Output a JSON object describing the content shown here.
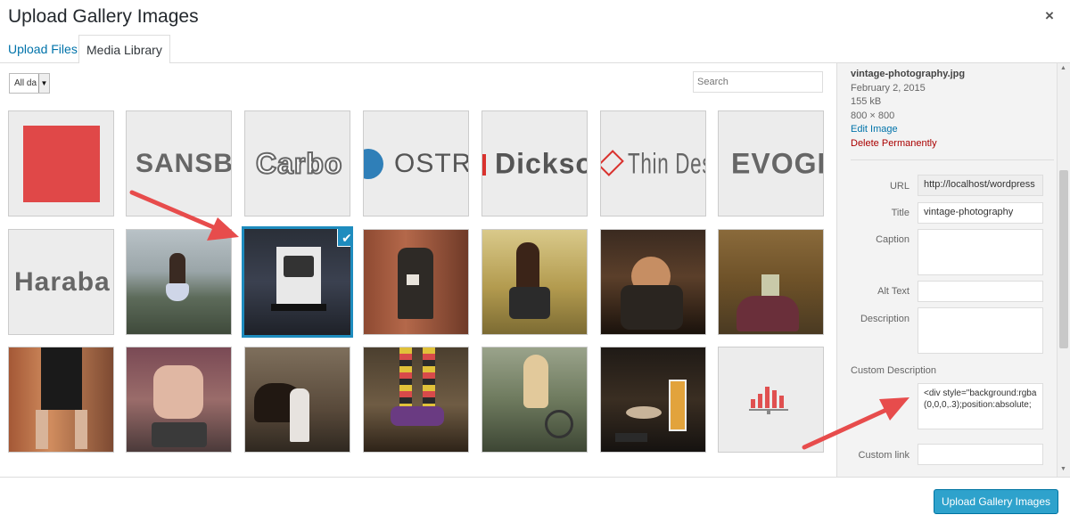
{
  "modal": {
    "title": "Upload Gallery Images",
    "close_glyph": "×"
  },
  "tabs": [
    {
      "label": "Upload Files",
      "active": false
    },
    {
      "label": "Media Library",
      "active": true
    }
  ],
  "toolbar": {
    "filter_value": "All da",
    "search_placeholder": "Search"
  },
  "grid": {
    "items": [
      {
        "name": "red-square"
      },
      {
        "name": "SANSB"
      },
      {
        "name": "Carbo"
      },
      {
        "name": "OSTRIC"
      },
      {
        "name": "Dickso"
      },
      {
        "name": "Thin Desig"
      },
      {
        "name": "EVOGR"
      },
      {
        "name": "Haraba"
      },
      {
        "name": "girl-on-cliff"
      },
      {
        "name": "vintage-photography",
        "selected": true
      },
      {
        "name": "girl-with-cup"
      },
      {
        "name": "girl-in-field"
      },
      {
        "name": "man-at-night"
      },
      {
        "name": "legs-in-leaves"
      },
      {
        "name": "legs-boots"
      },
      {
        "name": "sneakers"
      },
      {
        "name": "girl-with-horse"
      },
      {
        "name": "striped-socks"
      },
      {
        "name": "girl-with-bike"
      },
      {
        "name": "beer-table"
      },
      {
        "name": "chart-placeholder"
      }
    ],
    "logo_texts": {
      "sansb": "SANSB",
      "carbo": "Carbo",
      "ostric": "OSTRIC",
      "dickso": "Dickso",
      "thin": "Thin Desig",
      "evogr": "EVOGR",
      "haraba": "Haraba"
    },
    "check_glyph": "✔"
  },
  "details": {
    "filename": "vintage-photography.jpg",
    "date": "February 2, 2015",
    "size": "155 kB",
    "dimensions": "800 × 800",
    "edit_link": "Edit Image",
    "delete_link": "Delete Permanently",
    "fields": {
      "url_label": "URL",
      "url_value": "http://localhost/wordpress",
      "title_label": "Title",
      "title_value": "vintage-photography",
      "caption_label": "Caption",
      "alt_label": "Alt Text",
      "description_label": "Description",
      "custom_description_label": "Custom Description",
      "custom_description_value": "<div style=\"background:rgba(0,0,0,.3);position:absolute;",
      "custom_link_label": "Custom link"
    }
  },
  "footer": {
    "primary_button": "Upload Gallery Images"
  },
  "colors": {
    "accent": "#2ea2cc",
    "selected_border": "#1e8cbe",
    "arrow": "#e74c4c",
    "link": "#0073aa",
    "delete": "#aa0000"
  }
}
